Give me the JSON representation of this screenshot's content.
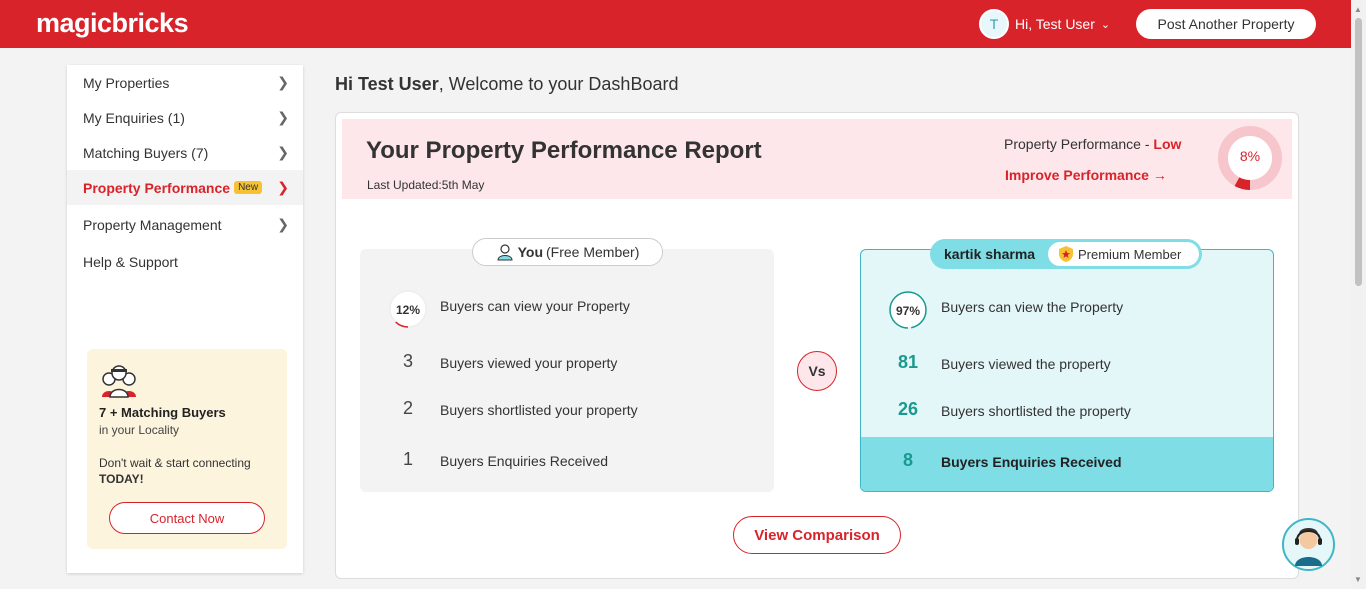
{
  "header": {
    "logo": "magicbricks",
    "user_initial": "T",
    "user_greeting": "Hi, Test User",
    "post_button": "Post Another Property"
  },
  "sidebar": {
    "items": [
      {
        "label": "My Properties"
      },
      {
        "label": "My Enquiries (1)"
      },
      {
        "label": "Matching Buyers (7)"
      },
      {
        "label": "Property Performance",
        "badge": "New"
      },
      {
        "label": "Property Management"
      },
      {
        "label": "Help & Support"
      }
    ],
    "promo": {
      "title": "7 + Matching Buyers",
      "subtitle": "in your Locality",
      "text": "Don't wait & start connecting",
      "emphasis": "TODAY!",
      "button": "Contact Now"
    }
  },
  "main": {
    "greeting_name": "Hi Test User",
    "greeting_rest": ", Welcome to your DashBoard",
    "report": {
      "title": "Your Property Performance Report",
      "last_updated": "Last Updated:5th May",
      "performance_label": "Property Performance - ",
      "performance_level": "Low",
      "improve_link": "Improve Performance →",
      "score": "8%",
      "score_value": 8
    },
    "you": {
      "name": "You",
      "membership": "(Free Member)",
      "view_pct": "12%",
      "view_pct_value": 12,
      "view_text": "Buyers can view your Property",
      "rows": [
        {
          "value": "3",
          "text": "Buyers viewed your property"
        },
        {
          "value": "2",
          "text": "Buyers shortlisted your property"
        },
        {
          "value": "1",
          "text": "Buyers Enquiries Received"
        }
      ]
    },
    "vs": "Vs",
    "premium": {
      "name": "kartik sharma",
      "membership": "Premium Member",
      "view_pct": "97%",
      "view_pct_value": 97,
      "view_text": "Buyers can view the Property",
      "rows": [
        {
          "value": "81",
          "text": "Buyers viewed the property"
        },
        {
          "value": "26",
          "text": "Buyers shortlisted the property"
        },
        {
          "value": "8",
          "text": "Buyers Enquiries Received"
        }
      ]
    },
    "compare_button": "View Comparison"
  },
  "colors": {
    "brand": "#d8232a",
    "teal": "#3fb6c6",
    "highlight": "#7fdde6"
  }
}
